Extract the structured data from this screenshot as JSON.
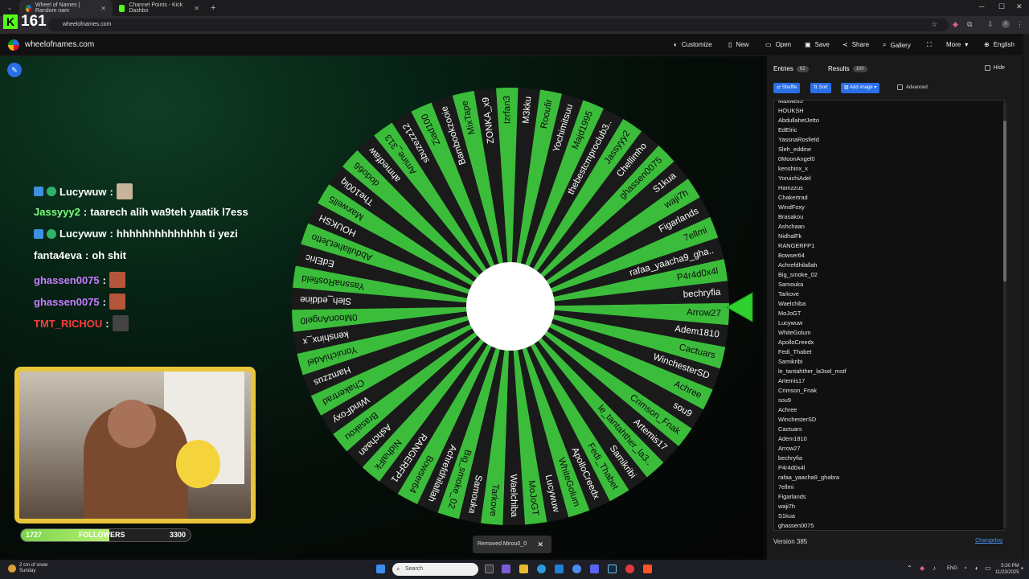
{
  "browser": {
    "counter": "161",
    "tabs": [
      {
        "title": "Wheel of Names | Random nam",
        "icon": "wheel-icon"
      },
      {
        "title": "Channel Points - Kick Dashbo",
        "icon": "kick-icon"
      }
    ],
    "url": "wheelofnames.com"
  },
  "site": {
    "name": "wheelofnames.com",
    "menu": [
      "Customize",
      "New",
      "Open",
      "Save",
      "Share",
      "Gallery",
      "More",
      "English"
    ]
  },
  "chat": [
    {
      "user": "Lucywuw",
      "color": "#ffffff",
      "msg": "",
      "emote": true,
      "badges": true
    },
    {
      "user": "Jassyyy2",
      "color": "#7bff7b",
      "msg": "taarech alih wa9teh yaatik l7ess",
      "emote": false,
      "badges": false
    },
    {
      "user": "Lucywuw",
      "color": "#ffffff",
      "msg": "hhhhhhhhhhhhhh ti yezi",
      "emote": false,
      "badges": true
    },
    {
      "user": "fanta4eva",
      "color": "#ffffff",
      "msg": "oh shit",
      "emote": false,
      "badges": false
    },
    {
      "user": "ghassen0075",
      "color": "#c77dff",
      "msg": "",
      "emote": true,
      "badges": false
    },
    {
      "user": "ghassen0075",
      "color": "#c77dff",
      "msg": "",
      "emote": true,
      "badges": false
    },
    {
      "user": "TMT_RICHOU",
      "color": "#ff3b3b",
      "msg": "",
      "emote": true,
      "badges": false
    }
  ],
  "followers": {
    "current": "1727",
    "label": "FOLLOWERS",
    "goal": "3300",
    "progress": 0.523
  },
  "toast": {
    "text": "Removed Mirou0_0"
  },
  "wheel": {
    "colors": [
      "#3bbd3b",
      "#1a1a1a"
    ],
    "slices": [
      "Arrow27",
      "bechryfia",
      "P4r4d0x4l",
      "rafaa_yaacha9_gha..",
      "7ellmi",
      "Figarlands",
      "waji7h",
      "S1kua",
      "ghassen0075",
      "Chellimho",
      "Jassyyy2",
      "thebestcmproclub3..",
      "Majd1995",
      "Yochimitsuu",
      "Rooufir",
      "M3kku",
      "Izrfan3",
      "ZONKA_x9",
      "MixTape",
      "Bambookzooie",
      "Ziad100",
      "sbuzezz12",
      "Amine_313",
      "ahmedfaw",
      "dodo66",
      "The100iq",
      "Maxwell5",
      "HOUKSH",
      "AbdullahetJetto",
      "EdElric",
      "YassnaRosfield",
      "Sleh_eddine",
      "0MoonAngel0",
      "kenshinx_x",
      "YoruichiAdel",
      "Hamzzus",
      "Chakertrad",
      "WindFoxy",
      "Brasakou",
      "Ashchaan",
      "NidhalFk",
      "RANGERFP1",
      "Bowser64",
      "Achrefdhilallah",
      "Big_smoke_02",
      "Samouka",
      "Tarkove",
      "Waelchiba",
      "MoJoGT",
      "Lucywuw",
      "WhiteGolum",
      "ApolloCreedx",
      "Fedi_Thabet",
      "Samikribi",
      "le_tantahther_la3..",
      "Artemis17",
      "Crimson_Fnak",
      "sou9",
      "Achree",
      "WinchesterSD",
      "Cactuars",
      "Adem1810"
    ]
  },
  "sidebar": {
    "tab_entries": "Entries",
    "entries_count": "62",
    "tab_results": "Results",
    "results_count": "100",
    "hide_label": "Hide",
    "btn_shuffle": "Shuffle",
    "btn_sort": "Sort",
    "btn_add_image": "Add image",
    "advanced_label": "Advanced",
    "entries": [
      "Maxwell5",
      "HOUKSH",
      "AbdullahetJetto",
      "EdElric",
      "YassnaRosfield",
      "Sleh_eddine",
      "0MoonAngel0",
      "kenshinx_x",
      "YoruichiAdel",
      "Hamzzus",
      "Chakertrad",
      "WindFoxy",
      "Brasakou",
      "Ashchaan",
      "NidhalFk",
      "RANGERFP1",
      "Bowser64",
      "Achrefdhilallah",
      "Big_smoke_02",
      "Samouka",
      "Tarkove",
      "Waelchiba",
      "MoJoGT",
      "Lucywuw",
      "WhiteGolum",
      "ApolloCreedx",
      "Fedi_Thabet",
      "Samikribi",
      "le_tantahther_la3sel_mstf",
      "Artemis17",
      "Crimson_Fnak",
      "sou9",
      "Achree",
      "WinchesterSD",
      "Cactuars",
      "Adem1810",
      "Arrow27",
      "bechryfia",
      "P4r4d0x4l",
      "rafaa_yaacha9_ghabra",
      "7ellmi",
      "Figarlands",
      "waji7h",
      "S1kua",
      "ghassen0075"
    ],
    "version": "Version 385",
    "changelog": "Changelog"
  },
  "taskbar": {
    "weather_line1": "2 cm of snow",
    "weather_line2": "Sunday",
    "search_placeholder": "Search",
    "lang": "ENG",
    "time": "5:30 PM",
    "date": "11/23/2025"
  }
}
